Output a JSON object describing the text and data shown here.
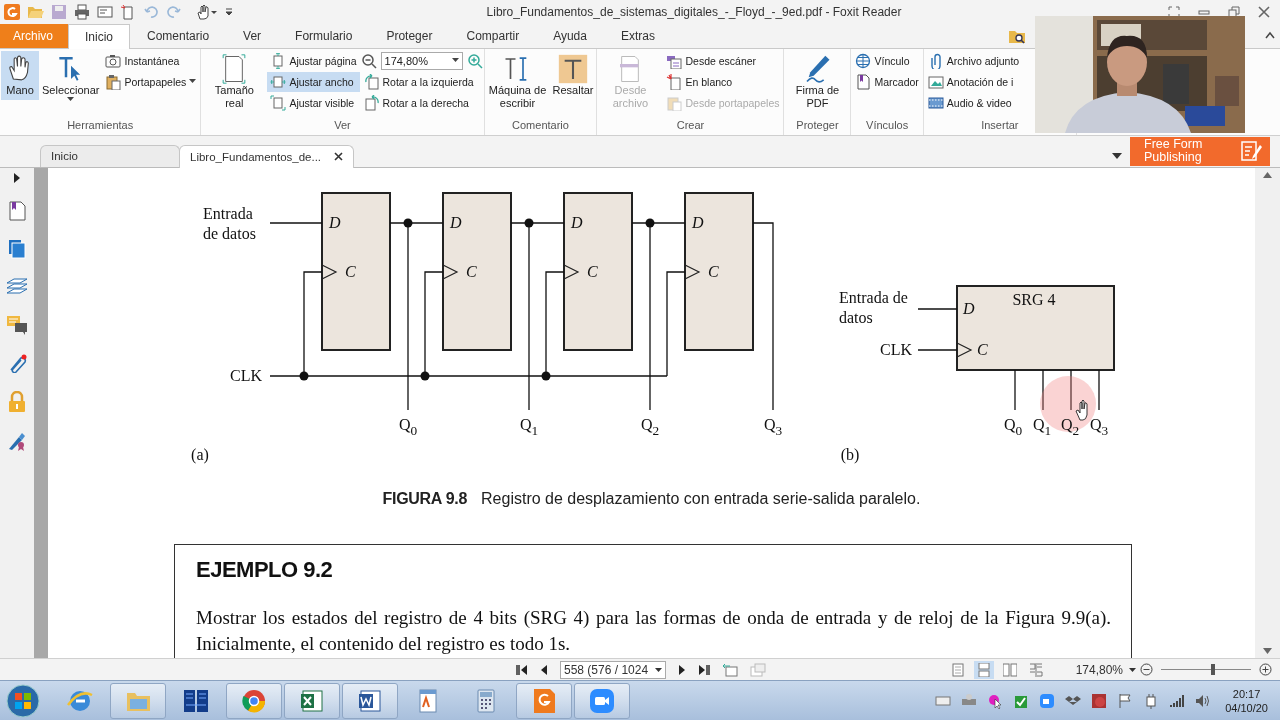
{
  "title_bar": {
    "title": "Libro_Fundamentos_de_sistemas_digitales_-_Floyd_-_9ed.pdf - Foxit Reader"
  },
  "ribbon_tabs": [
    {
      "label": "Archivo",
      "kind": "file",
      "selected": false
    },
    {
      "label": "Inicio",
      "kind": "tab",
      "selected": true
    },
    {
      "label": "Comentario",
      "kind": "tab",
      "selected": false
    },
    {
      "label": "Ver",
      "kind": "tab",
      "selected": false
    },
    {
      "label": "Formulario",
      "kind": "tab",
      "selected": false
    },
    {
      "label": "Proteger",
      "kind": "tab",
      "selected": false
    },
    {
      "label": "Compartir",
      "kind": "tab",
      "selected": false
    },
    {
      "label": "Ayuda",
      "kind": "tab",
      "selected": false
    },
    {
      "label": "Extras",
      "kind": "tab",
      "selected": false
    }
  ],
  "ribbon_groups": [
    {
      "label": "Herramientas",
      "columns": [
        [
          {
            "kind": "large",
            "label": "Mano",
            "selected": true,
            "disabled": false,
            "menu": false
          }
        ],
        [
          {
            "kind": "large",
            "label": "Seleccionar",
            "selected": false,
            "disabled": false,
            "menu": true
          }
        ],
        [
          {
            "kind": "small",
            "label": "Instantánea",
            "selected": false,
            "disabled": false,
            "menu": false
          },
          {
            "kind": "small",
            "label": "Portapapeles",
            "selected": false,
            "disabled": false,
            "menu": true
          }
        ]
      ]
    },
    {
      "label": "Ver",
      "columns": [
        [
          {
            "kind": "large",
            "label": "Tamaño real",
            "selected": false,
            "disabled": false,
            "menu": false
          }
        ],
        [
          {
            "kind": "small",
            "label": "Ajustar página",
            "selected": false,
            "disabled": false,
            "menu": false
          },
          {
            "kind": "small",
            "label": "Ajustar ancho",
            "selected": true,
            "disabled": false,
            "menu": false
          },
          {
            "kind": "small",
            "label": "Ajustar visible",
            "selected": false,
            "disabled": false,
            "menu": false
          }
        ],
        [
          {
            "kind": "zoom",
            "value": "174,80%",
            "menu": true
          },
          {
            "kind": "small",
            "label": "Rotar a la izquierda",
            "selected": false,
            "disabled": false,
            "menu": false
          },
          {
            "kind": "small",
            "label": "Rotar a la derecha",
            "selected": false,
            "disabled": false,
            "menu": false
          }
        ]
      ]
    },
    {
      "label": "Comentario",
      "columns": [
        [
          {
            "kind": "large",
            "label": "Máquina de escribir",
            "selected": false,
            "disabled": false,
            "menu": false
          }
        ],
        [
          {
            "kind": "large",
            "label": "Resaltar",
            "selected": false,
            "disabled": false,
            "menu": false
          }
        ]
      ]
    },
    {
      "label": "Crear",
      "columns": [
        [
          {
            "kind": "large",
            "label": "Desde archivo",
            "selected": false,
            "disabled": true,
            "menu": false
          }
        ],
        [
          {
            "kind": "small",
            "label": "Desde escáner",
            "selected": false,
            "disabled": false,
            "menu": false
          },
          {
            "kind": "small",
            "label": "En blanco",
            "selected": false,
            "disabled": false,
            "menu": false
          },
          {
            "kind": "small",
            "label": "Desde portapapeles",
            "selected": false,
            "disabled": true,
            "menu": false
          }
        ]
      ]
    },
    {
      "label": "Proteger",
      "columns": [
        [
          {
            "kind": "large",
            "label": "Firma de PDF",
            "selected": false,
            "disabled": false,
            "menu": false
          }
        ]
      ]
    },
    {
      "label": "Vínculos",
      "columns": [
        [
          {
            "kind": "small",
            "label": "Vínculo",
            "selected": false,
            "disabled": false,
            "menu": false
          },
          {
            "kind": "small",
            "label": "Marcador",
            "selected": false,
            "disabled": false,
            "menu": false
          }
        ]
      ]
    },
    {
      "label": "Insertar",
      "columns": [
        [
          {
            "kind": "small",
            "label": "Archivo adjunto",
            "selected": false,
            "disabled": false,
            "menu": false
          },
          {
            "kind": "small",
            "label": "Anotación de i",
            "selected": false,
            "disabled": false,
            "menu": false
          },
          {
            "kind": "small",
            "label": "Audio & video",
            "selected": false,
            "disabled": false,
            "menu": false
          }
        ]
      ]
    }
  ],
  "document_tabs": [
    {
      "label": "Inicio",
      "selected": false,
      "closable": false
    },
    {
      "label": "Libro_Fundamentos_de...",
      "selected": true,
      "closable": true
    }
  ],
  "promo_banner": {
    "text": "Free Form Publishing"
  },
  "document": {
    "figure": {
      "circuit_a": {
        "input_label": "Entrada de datos",
        "clock_label": "CLK",
        "flip_flops": [
          {
            "d": "D",
            "c": "C"
          },
          {
            "d": "D",
            "c": "C"
          },
          {
            "d": "D",
            "c": "C"
          },
          {
            "d": "D",
            "c": "C"
          }
        ],
        "outputs": [
          "Q$_{0}$",
          "Q$_{1}$",
          "Q$_{2}$",
          "Q$_{3}$"
        ],
        "caption": "(a)"
      },
      "circuit_b": {
        "input_label": "Entrada de datos",
        "clock_label": "CLK",
        "block_label": "SRG 4",
        "d": "D",
        "c": "C",
        "outputs": [
          "Q$_{0}$",
          "Q$_{1}$",
          "Q$_{2}$",
          "Q$_{3}$"
        ],
        "caption": "(b)"
      }
    },
    "caption": {
      "number": "FIGURA 9.8",
      "text": "Registro de desplazamiento con entrada serie-salida paralelo."
    },
    "example": {
      "title": "EJEMPLO 9.2",
      "text": "Mostrar los estados del registro de 4 bits (SRG 4) para las formas de onda de entrada y de reloj de la Figura 9.9(a). Inicialmente, el contenido del registro es todo 1s."
    }
  },
  "status_bar": {
    "page_field": "558 (576 / 1024",
    "view_modes": [
      {
        "selected": false
      },
      {
        "selected": true
      },
      {
        "selected": false
      },
      {
        "selected": false
      }
    ],
    "zoom": "174,80%",
    "zoom_slider": {
      "level": 0.58
    }
  },
  "taskbar": {
    "apps": [
      {
        "running": false
      },
      {
        "running": true
      },
      {
        "running": false
      },
      {
        "running": true
      },
      {
        "running": true
      },
      {
        "running": true
      },
      {
        "running": false
      },
      {
        "running": false
      },
      {
        "running": true
      },
      {
        "running": true
      }
    ],
    "clock": {
      "time": "20:17",
      "date": "04/10/20"
    }
  }
}
